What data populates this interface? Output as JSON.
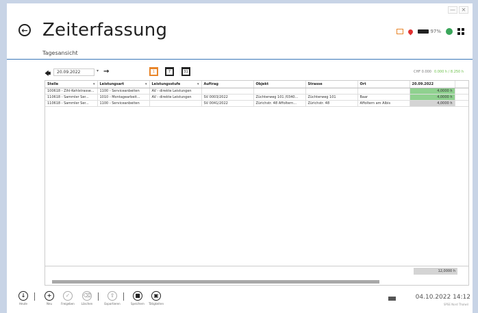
{
  "window": {
    "controls": [
      "—",
      "✕"
    ]
  },
  "header": {
    "title": "Zeiterfassung",
    "subtitle": "Tagesansicht",
    "battery": "97%"
  },
  "toolbar": {
    "date": "20.09.2022",
    "summary_left": "CHF 0.000",
    "summary_right": "0.000 h / 8.250 h",
    "calendar_labels": [
      "1",
      "7",
      "31"
    ]
  },
  "table": {
    "columns": [
      "Stelle",
      "Leistungsart",
      "Leistungsstufe",
      "Auftrag",
      "Objekt",
      "Strasse",
      "Ort",
      "20.09.2022"
    ],
    "rows": [
      [
        "100618 - Zihl-Kehlstrasse...",
        "1100 - Serviceanbeiten",
        "AV - direkte Leistungen",
        "",
        "",
        "",
        "",
        "4,0000 h"
      ],
      [
        "110618 - Sammler Ser...",
        "1010 - Montagearbeit...",
        "AV - direkte Leistungen",
        "SV 0003/2022",
        "Züchterweg 101 /0340...",
        "Züchterweg 101",
        "Baar",
        "4,0000 h"
      ],
      [
        "110618 - Sammler Ser...",
        "1100 - Serviceanbeiten",
        "",
        "SV 0041/2022",
        "Zürichstr. 48 Affoltern...",
        "Zürichstr. 48",
        "Affoltern am Albis",
        "4,0000 h"
      ]
    ],
    "total": "12,0000 h"
  },
  "bottom": {
    "buttons": [
      "Heute",
      "Neu",
      "Freigeben",
      "Löschen",
      "Exportieren",
      "Speichern",
      "Tätigkeiten"
    ],
    "datetime": "04.10.2022 14:12",
    "user": "SPSE Nord Thalwil"
  }
}
